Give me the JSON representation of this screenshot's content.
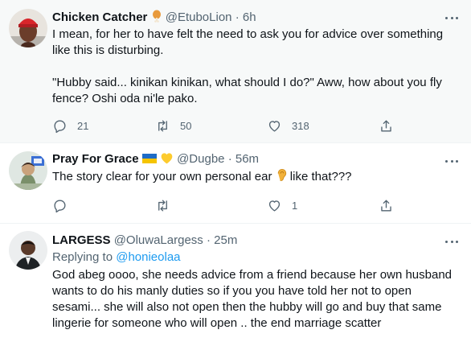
{
  "tweets": [
    {
      "display_name": "Chicken Catcher",
      "name_emoji": "chicken-leg-emoji",
      "handle": "@EtuboLion",
      "dot": "·",
      "time": "6h",
      "text": "I mean, for her to have felt the need to ask you for advice over something\nlike this is disturbing.\n\n\"Hubby said... kinikan kinikan, what should I do?\" Aww, how about you fly\nfence? Oshi oda ni'le pako.",
      "replies": "21",
      "retweets": "50",
      "likes": "318",
      "share": ""
    },
    {
      "display_name": "Pray For Grace",
      "name_emoji": "ukraine-flag-and-yellow-heart-emoji",
      "handle": "@Dugbe",
      "dot": "·",
      "time": "56m",
      "text_before": "The story clear for your own personal ear ",
      "text_after": " like that???",
      "inline_emoji": "ear-emoji",
      "replies": "",
      "retweets": "",
      "likes": "1",
      "share": ""
    },
    {
      "display_name": "LARGESS",
      "handle": "@OluwaLargess",
      "dot": "·",
      "time": "25m",
      "replying_prefix": "Replying to ",
      "replying_to": "@honieolaa",
      "text": "God abeg oooo, she needs advice from a friend because her own husband\nwants to do his manly duties so if you you have told her not to open\nsesami... she will also not open then the hubby will go and buy that same\nlingerie for someone who will open .. the end marriage scatter"
    }
  ],
  "colors": {
    "highlight_bg": "#f7f9f9",
    "text": "#0f1419",
    "muted": "#536471",
    "link": "#1d9bf0",
    "divider": "#eff3f4"
  }
}
